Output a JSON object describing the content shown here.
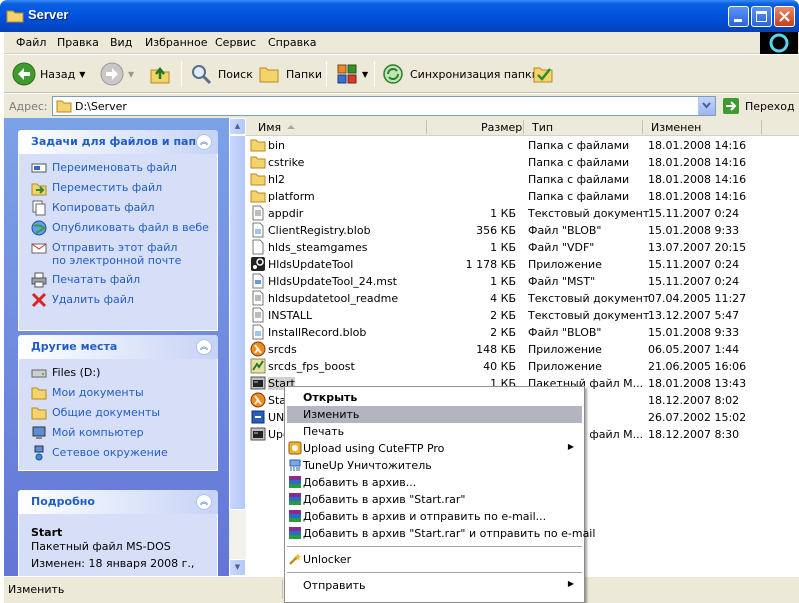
{
  "window": {
    "title": "Server"
  },
  "menu": [
    "Файл",
    "Правка",
    "Вид",
    "Избранное",
    "Сервис",
    "Справка"
  ],
  "toolbar": {
    "back": "Назад",
    "search": "Поиск",
    "folders": "Папки",
    "sync": "Синхронизация папки"
  },
  "address": {
    "label": "Адрес:",
    "value": "D:\\Server",
    "go": "Переход"
  },
  "tasks": {
    "title": "Задачи для файлов и папок",
    "items": [
      "Переименовать файл",
      "Переместить файл",
      "Копировать файл",
      "Опубликовать файл в вебе",
      "Отправить этот файл по электронной почте",
      "Печатать файл",
      "Удалить файл"
    ]
  },
  "places": {
    "title": "Другие места",
    "items": [
      "Files (D:)",
      "Мои документы",
      "Общие документы",
      "Мой компьютер",
      "Сетевое окружение"
    ]
  },
  "details": {
    "title": "Подробно",
    "name": "Start",
    "type": "Пакетный файл MS-DOS",
    "modified": "Изменен: 18 января 2008 г.,"
  },
  "columns": {
    "name": "Имя",
    "size": "Размер",
    "type": "Тип",
    "modified": "Изменен"
  },
  "files": [
    {
      "name": "bin",
      "size": "",
      "type": "Папка с файлами",
      "date": "18.01.2008 14:16",
      "icon": "folder-icon"
    },
    {
      "name": "cstrike",
      "size": "",
      "type": "Папка с файлами",
      "date": "18.01.2008 14:16",
      "icon": "folder-icon"
    },
    {
      "name": "hl2",
      "size": "",
      "type": "Папка с файлами",
      "date": "18.01.2008 14:16",
      "icon": "folder-icon"
    },
    {
      "name": "platform",
      "size": "",
      "type": "Папка с файлами",
      "date": "18.01.2008 14:16",
      "icon": "folder-icon"
    },
    {
      "name": "appdir",
      "size": "1 КБ",
      "type": "Текстовый документ",
      "date": "15.11.2007 0:24",
      "icon": "text-file-icon"
    },
    {
      "name": "ClientRegistry.blob",
      "size": "356 КБ",
      "type": "Файл \"BLOB\"",
      "date": "15.01.2008 9:33",
      "icon": "blob-file-icon"
    },
    {
      "name": "hlds_steamgames",
      "size": "1 КБ",
      "type": "Файл \"VDF\"",
      "date": "13.07.2007 20:15",
      "icon": "generic-file-icon"
    },
    {
      "name": "HldsUpdateTool",
      "size": "1 178 КБ",
      "type": "Приложение",
      "date": "15.11.2007 0:24",
      "icon": "steam-app-icon"
    },
    {
      "name": "HldsUpdateTool_24.mst",
      "size": "1 КБ",
      "type": "Файл \"MST\"",
      "date": "15.11.2007 0:24",
      "icon": "mst-file-icon"
    },
    {
      "name": "hldsupdatetool_readme",
      "size": "4 КБ",
      "type": "Текстовый документ",
      "date": "07.04.2005 11:27",
      "icon": "text-file-icon"
    },
    {
      "name": "INSTALL",
      "size": "2 КБ",
      "type": "Текстовый документ",
      "date": "13.12.2007 5:47",
      "icon": "text-file-icon"
    },
    {
      "name": "InstallRecord.blob",
      "size": "2 КБ",
      "type": "Файл \"BLOB\"",
      "date": "15.01.2008 9:33",
      "icon": "blob-file-icon"
    },
    {
      "name": "srcds",
      "size": "148 КБ",
      "type": "Приложение",
      "date": "06.05.2007 1:44",
      "icon": "halflife-app-icon"
    },
    {
      "name": "srcds_fps_boost",
      "size": "40 КБ",
      "type": "Приложение",
      "date": "21.06.2005 16:06",
      "icon": "boost-app-icon"
    },
    {
      "name": "Start",
      "size": "1 КБ",
      "type": "Пакетный файл M...",
      "date": "18.01.2008 13:43",
      "icon": "batch-file-icon"
    },
    {
      "name": "Sta",
      "size": "",
      "type": "",
      "date": "18.12.2007 8:02",
      "icon": "halflife-app-icon"
    },
    {
      "name": "UN",
      "size": "",
      "type": "",
      "date": "26.07.2002 15:02",
      "icon": "uninstall-icon"
    },
    {
      "name": "Upd",
      "size": "",
      "type": "Пакетный файл M...",
      "date": "18.12.2007 8:30",
      "icon": "batch-file-icon"
    }
  ],
  "context_menu": {
    "open": "Открыть",
    "edit": "Изменить",
    "print": "Печать",
    "cuteftp": "Upload using CuteFTP Pro",
    "tuneup": "TuneUp Уничтожитель",
    "add_archive": "Добавить в архив...",
    "add_start_rar": "Добавить в архив \"Start.rar\"",
    "add_email": "Добавить в архив и отправить по e-mail...",
    "add_start_email": "Добавить в архив \"Start.rar\" и отправить по e-mail",
    "unlocker": "Unlocker",
    "send_to": "Отправить"
  },
  "status": {
    "text": "Изменить"
  },
  "colors": {
    "title_blue": "#0052de",
    "task_blue": "#215dc6",
    "pane_gradient": "#7ba2e7"
  }
}
